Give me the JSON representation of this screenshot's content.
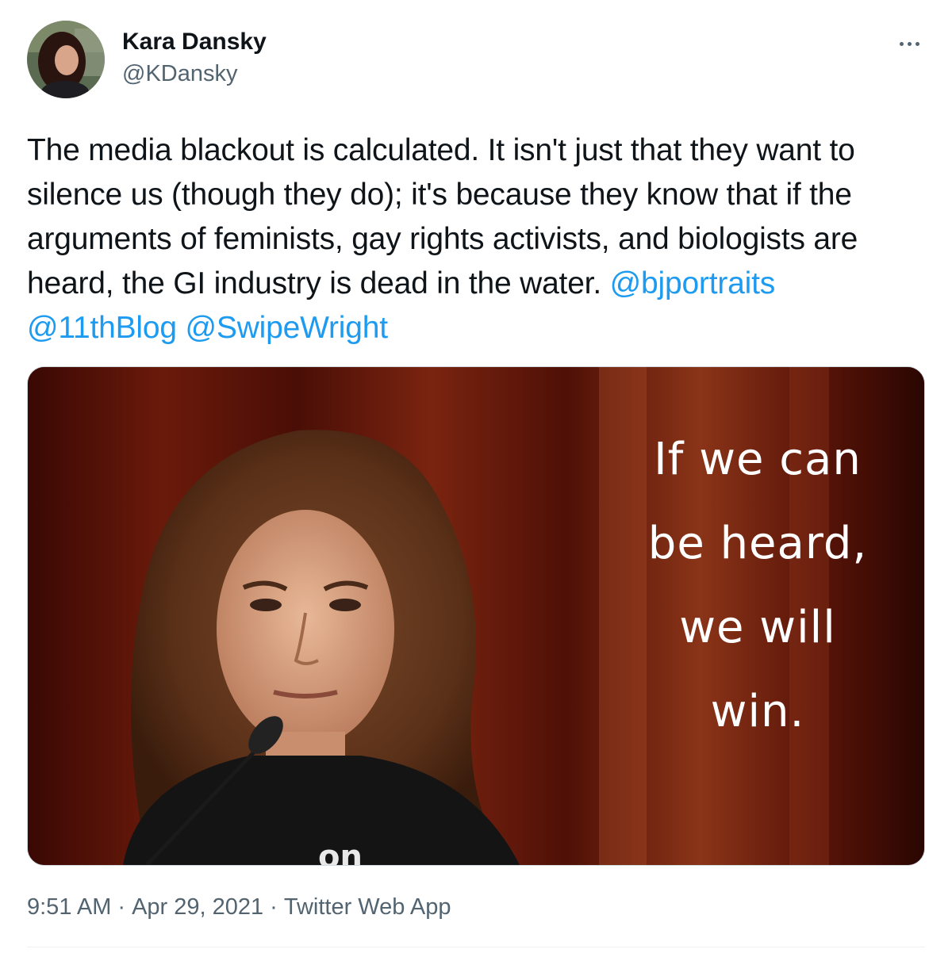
{
  "author": {
    "display_name": "Kara Dansky",
    "handle": "@KDansky",
    "avatar_icon": "profile-photo"
  },
  "more_icon": "more-dots-icon",
  "tweet": {
    "text": "The media blackout is calculated. It isn't just that they want to silence us (though they do); it's because they know that if the arguments of feminists, gay rights activists, and biologists are heard, the GI industry is dead in the water.",
    "mentions": [
      "@bjportraits",
      "@11thBlog",
      "@SwipeWright"
    ]
  },
  "media": {
    "caption_lines": [
      "If we can",
      "be heard,",
      "we will",
      "win."
    ],
    "partial_shirt_text": "on"
  },
  "meta": {
    "time": "9:51 AM",
    "date": "Apr 29, 2021",
    "source": "Twitter Web App",
    "separator": "·"
  },
  "colors": {
    "link": "#1d9bf0",
    "secondary_text": "#536471",
    "primary_text": "#0f1419"
  }
}
